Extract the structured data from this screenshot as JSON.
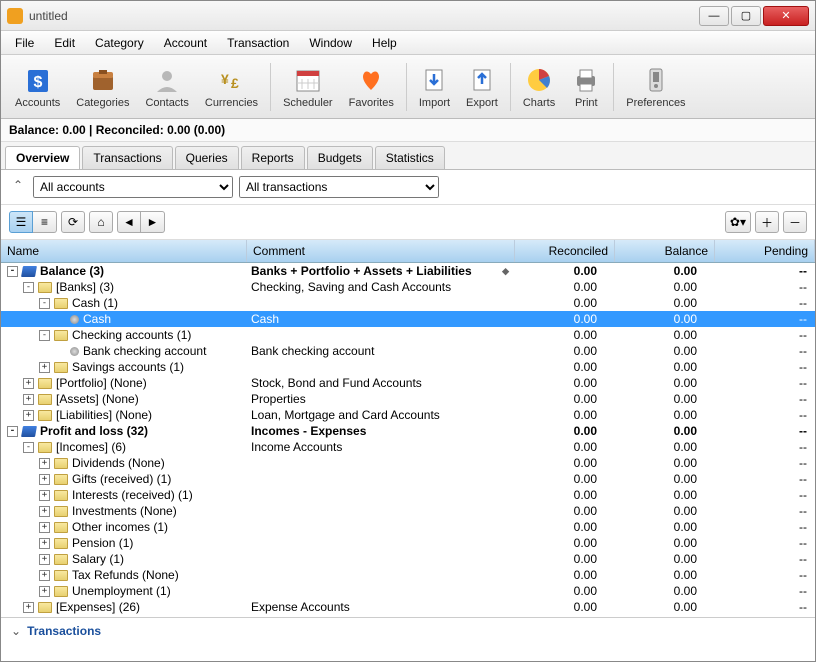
{
  "window": {
    "title": "untitled"
  },
  "menu": [
    "File",
    "Edit",
    "Category",
    "Account",
    "Transaction",
    "Window",
    "Help"
  ],
  "toolbar": [
    {
      "id": "accounts",
      "label": "Accounts"
    },
    {
      "id": "categories",
      "label": "Categories"
    },
    {
      "id": "contacts",
      "label": "Contacts"
    },
    {
      "id": "currencies",
      "label": "Currencies"
    },
    {
      "sep": true
    },
    {
      "id": "scheduler",
      "label": "Scheduler"
    },
    {
      "id": "favorites",
      "label": "Favorites"
    },
    {
      "sep": true
    },
    {
      "id": "import",
      "label": "Import"
    },
    {
      "id": "export",
      "label": "Export"
    },
    {
      "sep": true
    },
    {
      "id": "charts",
      "label": "Charts"
    },
    {
      "id": "print",
      "label": "Print"
    },
    {
      "sep": true
    },
    {
      "id": "preferences",
      "label": "Preferences"
    }
  ],
  "status": "Balance: 0.00 | Reconciled: 0.00 (0.00)",
  "tabs": [
    "Overview",
    "Transactions",
    "Queries",
    "Reports",
    "Budgets",
    "Statistics"
  ],
  "active_tab": 0,
  "filters": {
    "accounts": "All accounts",
    "transactions": "All transactions"
  },
  "columns": {
    "name": "Name",
    "comment": "Comment",
    "reconciled": "Reconciled",
    "balance": "Balance",
    "pending": "Pending"
  },
  "rows": [
    {
      "depth": 0,
      "exp": "-",
      "icon": "book",
      "name": "Balance (3)",
      "comment": "Banks + Portfolio + Assets + Liabilities",
      "sort": true,
      "rec": "0.00",
      "bal": "0.00",
      "pend": "--",
      "bold": true
    },
    {
      "depth": 1,
      "exp": "-",
      "icon": "folder",
      "name": "[Banks] (3)",
      "comment": "Checking, Saving and Cash Accounts",
      "rec": "0.00",
      "bal": "0.00",
      "pend": "--"
    },
    {
      "depth": 2,
      "exp": "-",
      "icon": "folder",
      "name": "Cash (1)",
      "comment": "",
      "rec": "0.00",
      "bal": "0.00",
      "pend": "--"
    },
    {
      "depth": 3,
      "exp": "",
      "icon": "dot",
      "name": "Cash",
      "comment": "Cash",
      "rec": "0.00",
      "bal": "0.00",
      "pend": "--",
      "selected": true
    },
    {
      "depth": 2,
      "exp": "-",
      "icon": "folder",
      "name": "Checking accounts (1)",
      "comment": "",
      "rec": "0.00",
      "bal": "0.00",
      "pend": "--"
    },
    {
      "depth": 3,
      "exp": "",
      "icon": "dot",
      "name": "Bank checking account",
      "comment": "Bank checking account",
      "rec": "0.00",
      "bal": "0.00",
      "pend": "--"
    },
    {
      "depth": 2,
      "exp": "+",
      "icon": "folder",
      "name": "Savings accounts (1)",
      "comment": "",
      "rec": "0.00",
      "bal": "0.00",
      "pend": "--"
    },
    {
      "depth": 1,
      "exp": "+",
      "icon": "folder",
      "name": "[Portfolio] (None)",
      "comment": "Stock, Bond and Fund Accounts",
      "rec": "0.00",
      "bal": "0.00",
      "pend": "--"
    },
    {
      "depth": 1,
      "exp": "+",
      "icon": "folder",
      "name": "[Assets] (None)",
      "comment": "Properties",
      "rec": "0.00",
      "bal": "0.00",
      "pend": "--"
    },
    {
      "depth": 1,
      "exp": "+",
      "icon": "folder",
      "name": "[Liabilities] (None)",
      "comment": "Loan, Mortgage and Card Accounts",
      "rec": "0.00",
      "bal": "0.00",
      "pend": "--"
    },
    {
      "depth": 0,
      "exp": "-",
      "icon": "book",
      "name": "Profit and loss (32)",
      "comment": "Incomes - Expenses",
      "rec": "0.00",
      "bal": "0.00",
      "pend": "--",
      "bold": true
    },
    {
      "depth": 1,
      "exp": "-",
      "icon": "folder",
      "name": "[Incomes] (6)",
      "comment": "Income Accounts",
      "rec": "0.00",
      "bal": "0.00",
      "pend": "--"
    },
    {
      "depth": 2,
      "exp": "+",
      "icon": "folder",
      "name": "Dividends (None)",
      "comment": "",
      "rec": "0.00",
      "bal": "0.00",
      "pend": "--"
    },
    {
      "depth": 2,
      "exp": "+",
      "icon": "folder",
      "name": "Gifts (received) (1)",
      "comment": "",
      "rec": "0.00",
      "bal": "0.00",
      "pend": "--"
    },
    {
      "depth": 2,
      "exp": "+",
      "icon": "folder",
      "name": "Interests (received) (1)",
      "comment": "",
      "rec": "0.00",
      "bal": "0.00",
      "pend": "--"
    },
    {
      "depth": 2,
      "exp": "+",
      "icon": "folder",
      "name": "Investments (None)",
      "comment": "",
      "rec": "0.00",
      "bal": "0.00",
      "pend": "--"
    },
    {
      "depth": 2,
      "exp": "+",
      "icon": "folder",
      "name": "Other incomes (1)",
      "comment": "",
      "rec": "0.00",
      "bal": "0.00",
      "pend": "--"
    },
    {
      "depth": 2,
      "exp": "+",
      "icon": "folder",
      "name": "Pension (1)",
      "comment": "",
      "rec": "0.00",
      "bal": "0.00",
      "pend": "--"
    },
    {
      "depth": 2,
      "exp": "+",
      "icon": "folder",
      "name": "Salary (1)",
      "comment": "",
      "rec": "0.00",
      "bal": "0.00",
      "pend": "--"
    },
    {
      "depth": 2,
      "exp": "+",
      "icon": "folder",
      "name": "Tax Refunds (None)",
      "comment": "",
      "rec": "0.00",
      "bal": "0.00",
      "pend": "--"
    },
    {
      "depth": 2,
      "exp": "+",
      "icon": "folder",
      "name": "Unemployment (1)",
      "comment": "",
      "rec": "0.00",
      "bal": "0.00",
      "pend": "--"
    },
    {
      "depth": 1,
      "exp": "+",
      "icon": "folder",
      "name": "[Expenses] (26)",
      "comment": "Expense Accounts",
      "rec": "0.00",
      "bal": "0.00",
      "pend": "--"
    }
  ],
  "bottom_panel": "Transactions",
  "icons_svg": {
    "accounts": "<svg width='28' height='28'><rect x='4' y='4' width='20' height='22' rx='2' fill='#2a6fd6'/><text x='14' y='21' text-anchor='middle' fill='#fff' font-size='16' font-weight='bold'>$</text></svg>",
    "categories": "<svg width='28' height='28'><rect x='4' y='10' width='20' height='14' rx='2' fill='#a0622d'/><rect x='4' y='6' width='20' height='6' rx='2' fill='#c88040'/><rect x='10' y='4' width='8' height='4' fill='#8a5020'/></svg>",
    "contacts": "<svg width='28' height='28'><circle cx='14' cy='10' r='5' fill='#b8b8b8'/><path d='M4 26 Q14 16 24 26' fill='#b8b8b8'/></svg>",
    "currencies": "<svg width='28' height='28'><text x='4' y='18' font-size='14' fill='#b89020' font-weight='bold'>¥</text><text x='14' y='22' font-size='14' fill='#b89020' font-weight='bold'>£</text></svg>",
    "scheduler": "<svg width='28' height='28'><rect x='3' y='5' width='22' height='20' fill='#fff' stroke='#888'/><rect x='3' y='5' width='22' height='5' fill='#d04040'/><line x1='8' y1='13' x2='8' y2='23' stroke='#ccc'/><line x1='14' y1='13' x2='14' y2='23' stroke='#ccc'/><line x1='20' y1='13' x2='20' y2='23' stroke='#ccc'/><line x1='3' y1='17' x2='25' y2='17' stroke='#ccc'/></svg>",
    "favorites": "<svg width='28' height='28'><path d='M14 24 C6 16 4 10 8 6 C11 4 14 8 14 8 C14 8 17 4 20 6 C24 10 22 16 14 24Z' fill='#ff7020'/></svg>",
    "import": "<svg width='28' height='28'><rect x='6' y='4' width='16' height='20' fill='#fff' stroke='#888'/><path d='M14 8 L14 18 M10 14 L14 18 L18 14' stroke='#2a6fd6' stroke-width='2.5' fill='none'/></svg>",
    "export": "<svg width='28' height='28'><rect x='6' y='4' width='16' height='20' fill='#fff' stroke='#888'/><path d='M14 18 L14 8 M10 12 L14 8 L18 12' stroke='#2a6fd6' stroke-width='2.5' fill='none'/></svg>",
    "charts": "<svg width='28' height='28'><circle cx='14' cy='14' r='11' fill='#ffcc40'/><path d='M14 14 L14 3 A11 11 0 0 1 24 10 Z' fill='#d04040'/><path d='M14 14 L24 10 A11 11 0 0 1 22 22 Z' fill='#4080d0'/></svg>",
    "print": "<svg width='28' height='28'><rect x='5' y='10' width='18' height='10' rx='2' fill='#888'/><rect x='8' y='4' width='12' height='8' fill='#fff' stroke='#888'/><rect x='8' y='18' width='12' height='7' fill='#fff' stroke='#888'/></svg>",
    "preferences": "<svg width='28' height='28'><rect x='8' y='3' width='12' height='22' rx='2' fill='#ddd' stroke='#888'/><rect x='11' y='6' width='6' height='10' fill='#888'/><circle cx='14' cy='20' r='2' fill='#888'/></svg>"
  }
}
